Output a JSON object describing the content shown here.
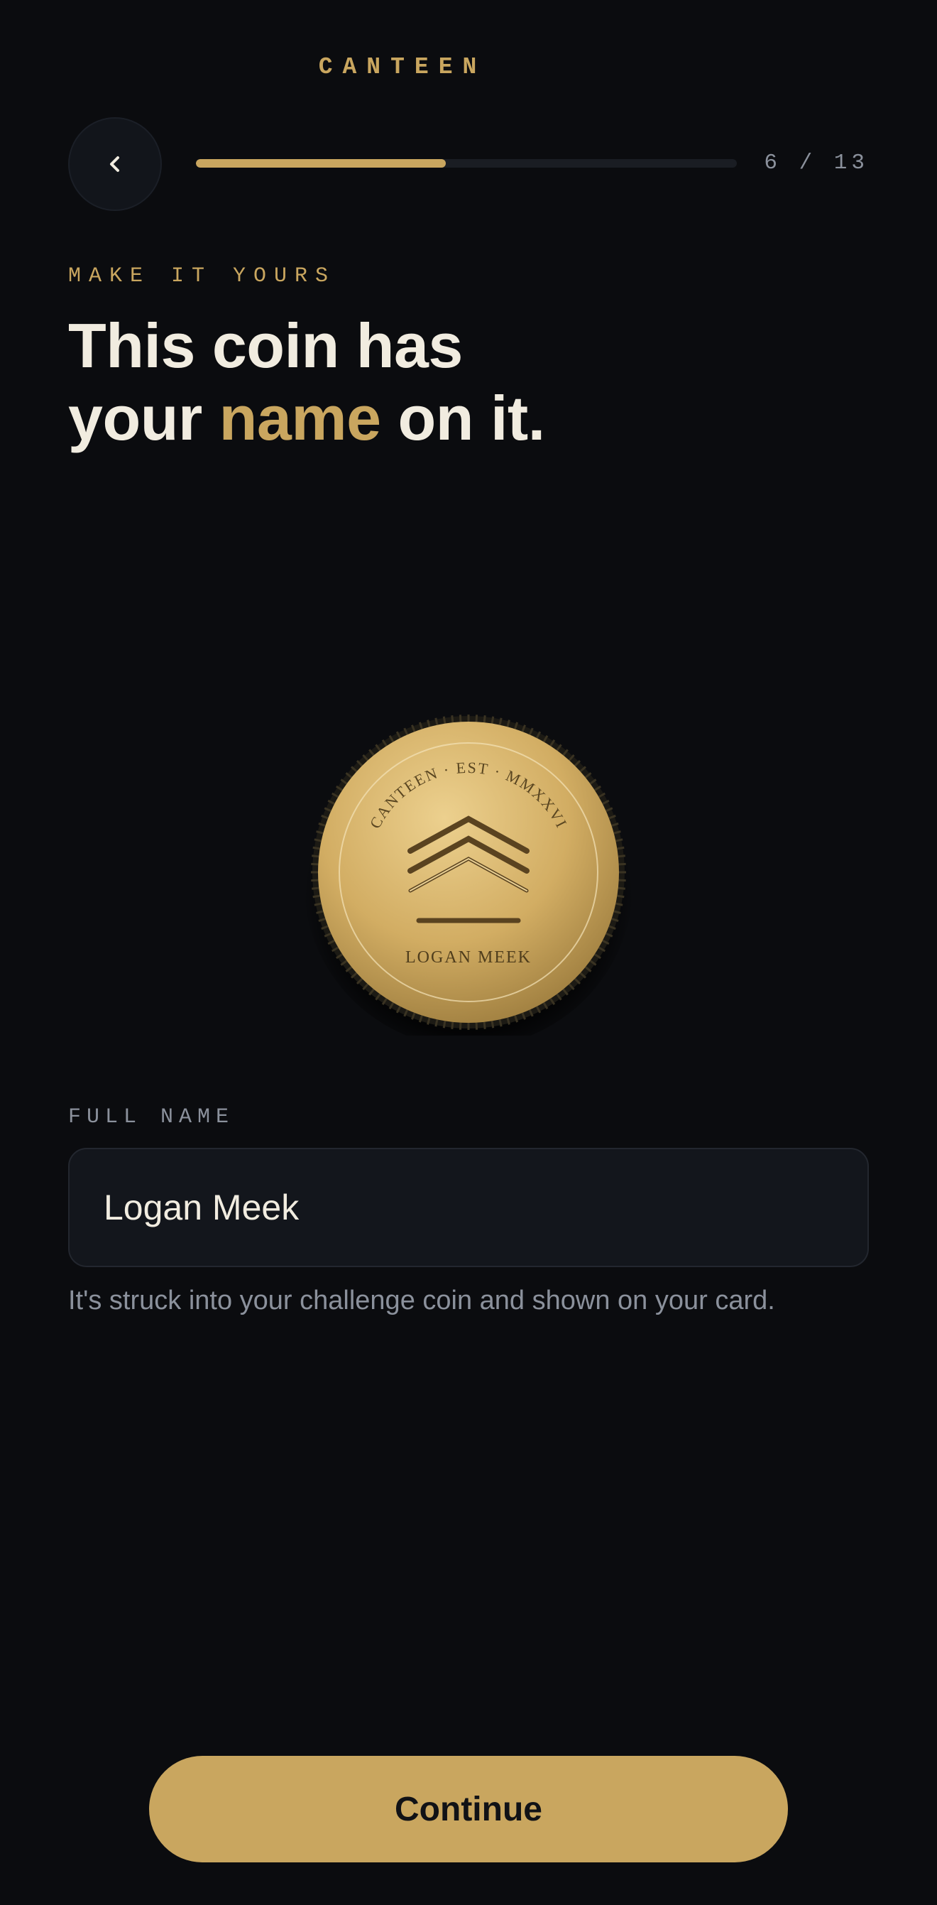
{
  "brand": "CANTEEN",
  "nav": {
    "back_icon": "chevron-left-icon",
    "progress_fraction": 0.4615,
    "step_label": "6 / 13"
  },
  "intro": {
    "eyebrow": "MAKE IT YOURS",
    "headline_line1": "This coin has",
    "headline_line2_pre": "your ",
    "headline_accent": "name",
    "headline_line2_post": " on it."
  },
  "coin": {
    "ring_text": "CANTEEN · EST · MMXXVI",
    "name_text": "LOGAN MEEK",
    "emblem_icon": "chevron-rank-icon"
  },
  "form": {
    "label": "FULL NAME",
    "value": "Logan Meek",
    "hint": "It's struck into your challenge coin and shown on your card."
  },
  "footer": {
    "continue_label": "Continue"
  },
  "colors": {
    "background": "#0b0c0f",
    "accent": "#c9a65f",
    "text": "#f1ece0",
    "muted": "#8b919c"
  }
}
